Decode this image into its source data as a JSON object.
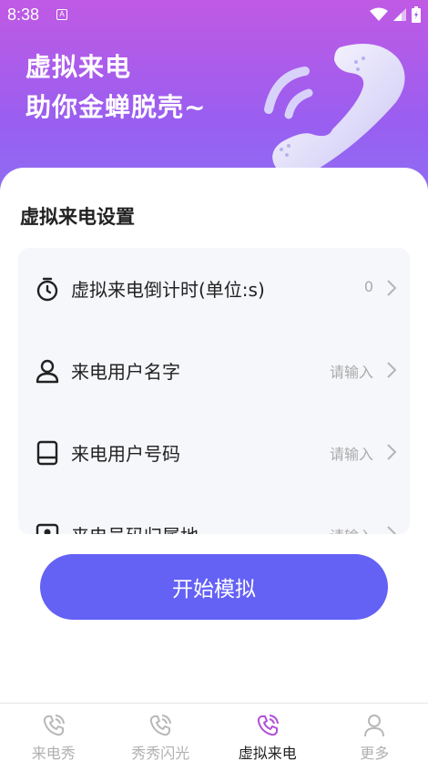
{
  "status": {
    "time": "8:38",
    "badge": "A"
  },
  "hero": {
    "line1": "虚拟来电",
    "line2": "助你金蝉脱壳~"
  },
  "settings": {
    "title": "虚拟来电设置",
    "rows": [
      {
        "label": "虚拟来电倒计时(单位:s)",
        "value": "0",
        "icon": "stopwatch-icon"
      },
      {
        "label": "来电用户名字",
        "value": "请输入",
        "icon": "user-icon"
      },
      {
        "label": "来电用户号码",
        "value": "请输入",
        "icon": "phone-device-icon"
      },
      {
        "label": "来电号码归属地",
        "value": "请输入",
        "icon": "id-card-icon"
      }
    ]
  },
  "start_button": "开始模拟",
  "tabs": [
    {
      "label": "来电秀",
      "icon": "phone-call-icon",
      "active": false
    },
    {
      "label": "秀秀闪光",
      "icon": "phone-call-icon",
      "active": false
    },
    {
      "label": "虚拟来电",
      "icon": "phone-call-icon",
      "active": true
    },
    {
      "label": "更多",
      "icon": "person-icon",
      "active": false
    }
  ],
  "colors": {
    "accent": "#6461f5",
    "header_top": "#c05ae4",
    "header_bottom": "#8a72f5",
    "active_tab_icon": "#b14fd8"
  }
}
